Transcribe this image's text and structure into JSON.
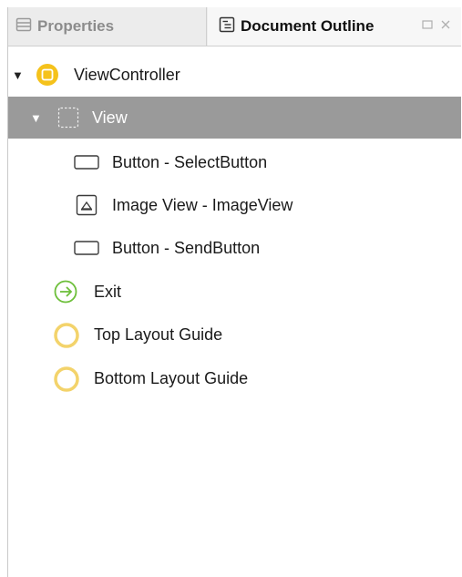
{
  "tabs": {
    "properties": "Properties",
    "document_outline": "Document Outline"
  },
  "outline": {
    "view_controller": "ViewController",
    "view": "View",
    "button_select": "Button - SelectButton",
    "image_view": "Image View - ImageView",
    "button_send": "Button - SendButton",
    "exit": "Exit",
    "top_layout_guide": "Top Layout Guide",
    "bottom_layout_guide": "Bottom Layout Guide"
  },
  "colors": {
    "selection": "#9a9a9a",
    "controller_yellow": "#f5c21b",
    "exit_green": "#6dbf3a",
    "guide_yellow": "#f3d36b"
  },
  "icons": {
    "properties_tab": "properties-icon",
    "outline_tab": "document-outline-icon",
    "view_controller": "view-controller-icon",
    "view": "view-icon",
    "button": "button-icon",
    "image_view": "image-view-icon",
    "exit": "exit-icon",
    "layout_guide": "layout-guide-icon"
  }
}
